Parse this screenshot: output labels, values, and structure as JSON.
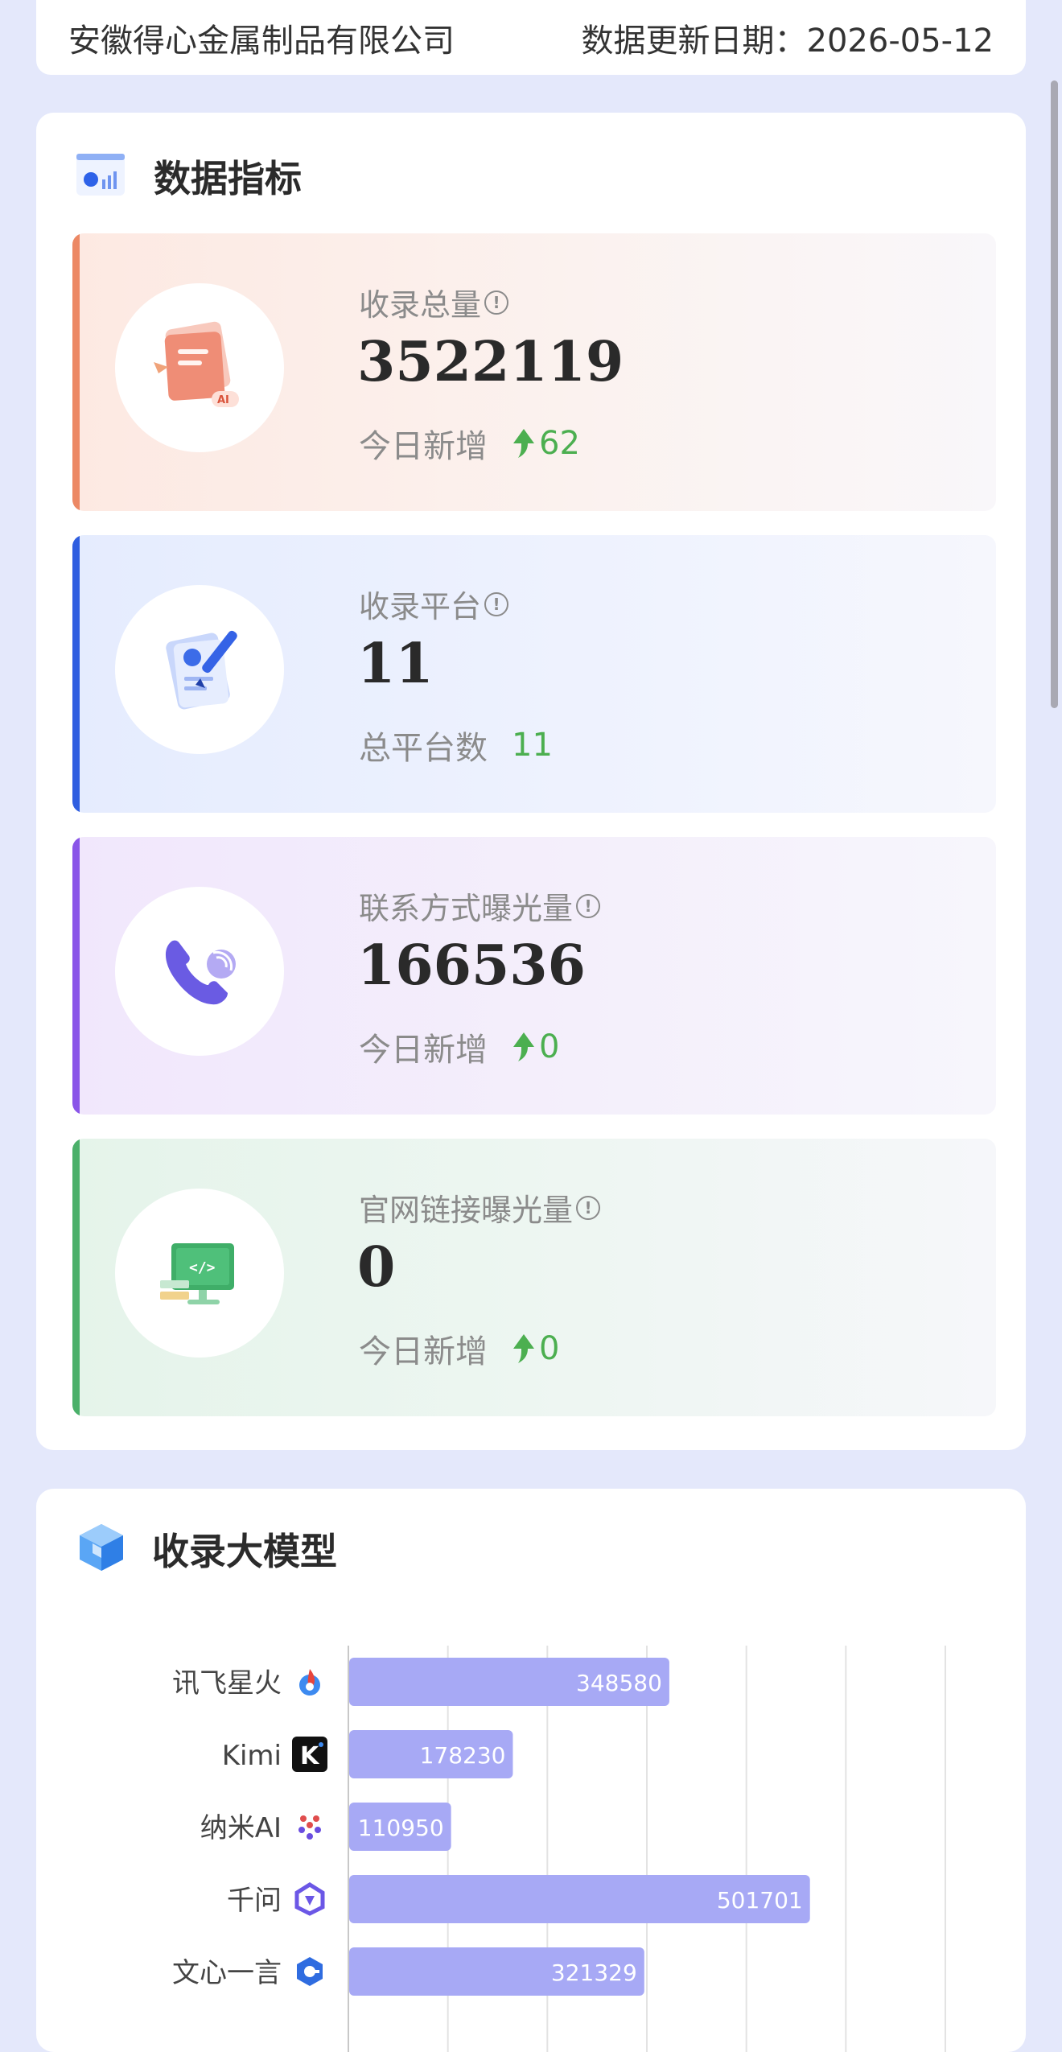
{
  "header": {
    "company": "安徽得心金属制品有限公司",
    "update_label": "数据更新日期：",
    "update_date": "2026-05-12"
  },
  "metrics_section": {
    "title": "数据指标"
  },
  "metrics": [
    {
      "label": "收录总量",
      "value": "3522119",
      "sub_label": "今日新增",
      "delta": "62",
      "icon": "document-ai-icon",
      "accent": "#ec8864"
    },
    {
      "label": "收录平台",
      "value": "11",
      "sub_label": "总平台数",
      "delta": "11",
      "icon": "clipboard-pen-icon",
      "accent": "#2f5ee0"
    },
    {
      "label": "联系方式曝光量",
      "value": "166536",
      "sub_label": "今日新增",
      "delta": "0",
      "icon": "phone-call-icon",
      "accent": "#8a55e8"
    },
    {
      "label": "官网链接曝光量",
      "value": "0",
      "sub_label": "今日新增",
      "delta": "0",
      "icon": "monitor-code-icon",
      "accent": "#4bb06a"
    }
  ],
  "models_section": {
    "title": "收录大模型"
  },
  "chart_data": {
    "type": "bar",
    "orientation": "horizontal",
    "categories": [
      "讯飞星火",
      "Kimi",
      "纳米AI",
      "千问",
      "文心一言"
    ],
    "values": [
      348580,
      178230,
      110950,
      501701,
      321329
    ],
    "xlim": [
      0,
      650000
    ],
    "grid": true,
    "bar_color": "#a7a9f5",
    "category_icons": [
      "spark-flame-icon",
      "kimi-logo-icon",
      "nami-logo-icon",
      "qianwen-logo-icon",
      "wenxin-logo-icon"
    ]
  }
}
